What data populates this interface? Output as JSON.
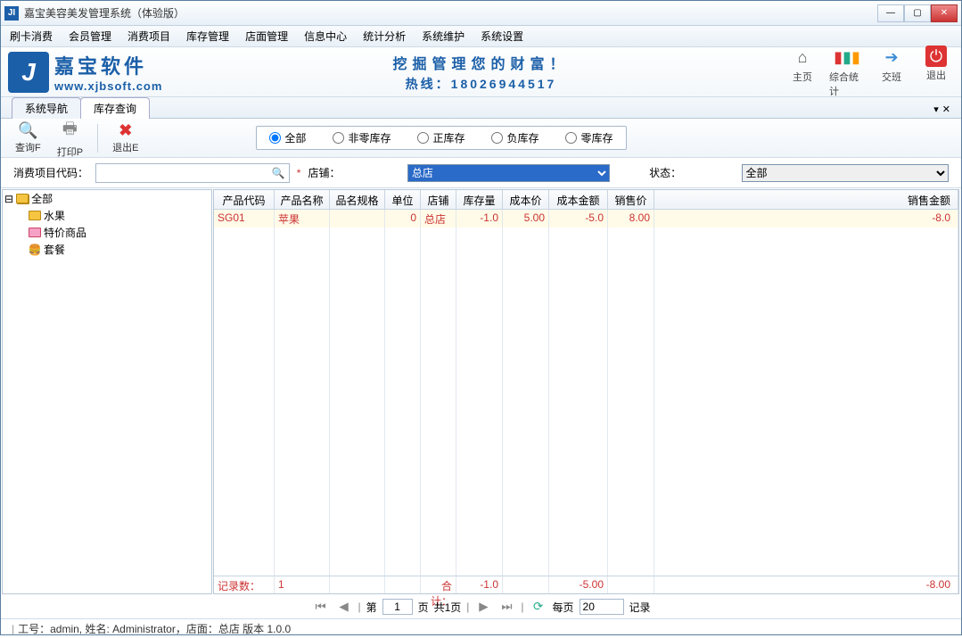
{
  "window": {
    "title": "嘉宝美容美发管理系统（体验版）"
  },
  "menu": {
    "items": [
      "刷卡消费",
      "会员管理",
      "消费项目",
      "库存管理",
      "店面管理",
      "信息中心",
      "统计分析",
      "系统维护",
      "系统设置"
    ]
  },
  "banner": {
    "brand_cn": "嘉宝软件",
    "brand_en": "www.xjbsoft.com",
    "slogan": "挖掘管理您的财富！",
    "hotline": "热线：18026944517",
    "buttons": [
      {
        "label": "主页",
        "icon": "home-icon",
        "glyph": "⌂",
        "color": "#555"
      },
      {
        "label": "综合统计",
        "icon": "stats-icon",
        "glyph": "▮▮▮",
        "color": "#2a8"
      },
      {
        "label": "交班",
        "icon": "shift-icon",
        "glyph": "➔",
        "color": "#3a8bd6"
      },
      {
        "label": "退出",
        "icon": "exit-icon",
        "glyph": "⏻",
        "color": "#d33"
      }
    ]
  },
  "tabs": {
    "items": [
      "系统导航",
      "库存查询"
    ],
    "active": 1
  },
  "toolbar": {
    "query": "查询F",
    "print": "打印P",
    "exit": "退出E"
  },
  "radios": {
    "items": [
      "全部",
      "非零库存",
      "正库存",
      "负库存",
      "零库存"
    ],
    "selected": 0
  },
  "filter": {
    "code_label": "消费项目代码：",
    "code_value": "",
    "store_label": "店铺：",
    "store_value": "总店",
    "status_label": "状态：",
    "status_value": "全部"
  },
  "tree": {
    "root": "全部",
    "children": [
      {
        "label": "水果",
        "icon": "folder-y"
      },
      {
        "label": "特价商品",
        "icon": "folder-g"
      },
      {
        "label": "套餐",
        "icon": "meal"
      }
    ]
  },
  "grid": {
    "columns": [
      "产品代码",
      "产品名称",
      "品名规格",
      "单位",
      "店铺",
      "库存量",
      "成本价",
      "成本金额",
      "销售价",
      "销售金额"
    ],
    "rows": [
      {
        "code": "SG01",
        "name": "苹果",
        "spec": "",
        "unit": "0",
        "store": "总店",
        "qty": "-1.0",
        "cost": "5.00",
        "cost_amt": "-5.0",
        "price": "8.00",
        "sale_amt": "-8.0"
      }
    ],
    "footer": {
      "label": "记录数：",
      "count": "1",
      "sum_label": "合计：",
      "qty": "-1.0",
      "cost_amt": "-5.00",
      "sale_amt": "-8.00"
    }
  },
  "pager": {
    "page_label_pre": "第",
    "page": "1",
    "page_label_post": "页",
    "total": "共1页",
    "perpage_label": "每页",
    "perpage": "20",
    "records_label": "记录"
  },
  "status": {
    "text": "工号：admin, 姓名: Administrator，店面：总店    版本 1.0.0"
  }
}
